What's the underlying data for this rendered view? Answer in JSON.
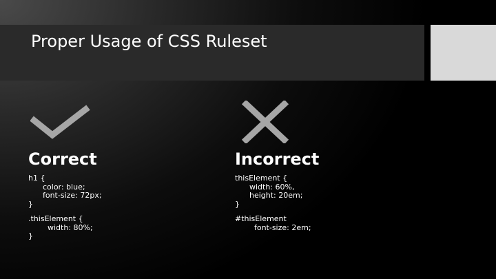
{
  "slide": {
    "title": "Proper Usage of CSS Ruleset"
  },
  "correct": {
    "heading": "Correct",
    "icon": "check-icon",
    "block1": "h1 {\n      color: blue;\n      font-size: 72px;\n}",
    "block2": ".thisElement {\n        width: 80%;\n}"
  },
  "incorrect": {
    "heading": "Incorrect",
    "icon": "x-icon",
    "block1": "thisElement {\n      width: 60%,\n      height: 20em;\n}",
    "block2": "#thisElement\n        font-size: 2em;"
  },
  "colors": {
    "title_bar": "#2a2a2a",
    "accent_block": "#d9d9d9",
    "icon": "#a6a6a6",
    "text": "#ffffff"
  }
}
